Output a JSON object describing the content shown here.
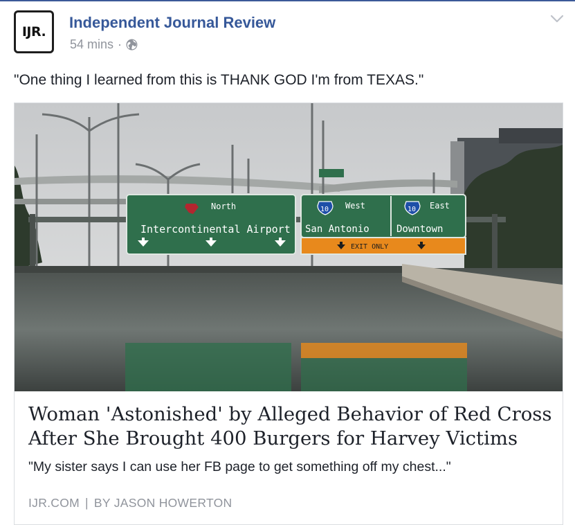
{
  "post": {
    "avatar_text": "IJR.",
    "page_name": "Independent Journal Review",
    "timestamp": "54 mins",
    "meta_separator": "·",
    "privacy_icon": "globe-icon",
    "menu_icon": "chevron-down-icon",
    "message": "\"One thing I learned from this is THANK GOD I'm from TEXAS.\""
  },
  "link_card": {
    "image": {
      "signs": {
        "north_label": "North",
        "airport_label": "Intercontinental Airport",
        "west_shield": "10",
        "west_label": "West",
        "west_destination": "San Antonio",
        "east_shield": "10",
        "east_label": "East",
        "east_destination": "Downtown",
        "exit_label": "EXIT ONLY"
      }
    },
    "headline": "Woman 'Astonished' by Alleged Behavior of Red Cross After She Brought 400 Burgers for Harvey Victims",
    "description": "\"My sister says I can use her FB page to get something off my chest...\"",
    "domain": "IJR.COM",
    "separator": "|",
    "byline": "BY JASON HOWERTON"
  },
  "colors": {
    "brand_link": "#365899",
    "secondary_text": "#90949c",
    "sign_green": "#2f6f4c",
    "exit_orange": "#e8891c"
  }
}
